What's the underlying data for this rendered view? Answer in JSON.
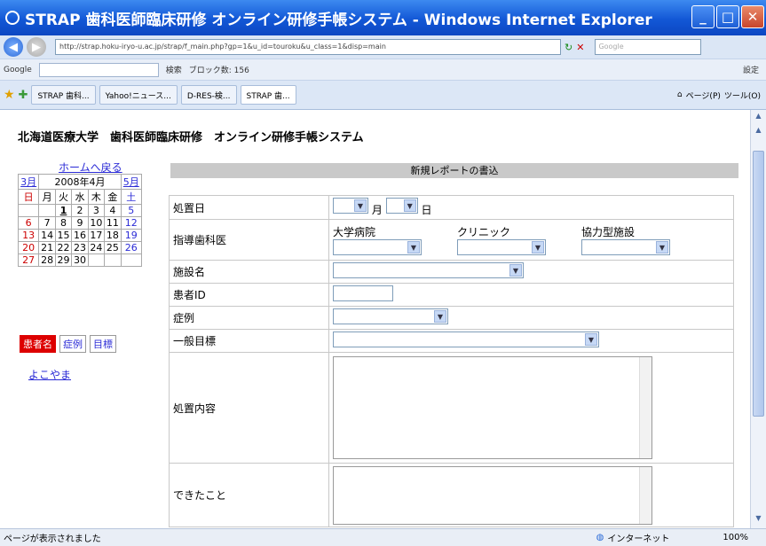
{
  "window": {
    "title": "STRAP 歯科医師臨床研修 オンライン研修手帳システム - Windows Internet Explorer",
    "url": "http://strap.hoku-iryo-u.ac.jp/strap/f_main.php?gp=1&u_id=touroku&u_class=1&disp=main",
    "search_placeholder": "Google"
  },
  "google_bar": {
    "label": "Google",
    "search_btn": "検索",
    "blocked": "ブロック数: 156",
    "settings": "設定"
  },
  "tabs": [
    {
      "label": "STRAP 歯科..."
    },
    {
      "label": "Yahoo!ニュース..."
    },
    {
      "label": "D-RES-検..."
    },
    {
      "label": "STRAP 歯..."
    }
  ],
  "toolbar": {
    "page": "ページ(P)",
    "tools": "ツール(O)"
  },
  "page": {
    "title": "北海道医療大学　歯科医師臨床研修　オンライン研修手帳システム",
    "home_link": "ホームへ戻る",
    "form_heading": "新規レポートの書込",
    "user_link": "よこやま"
  },
  "calendar": {
    "prev": "3月",
    "current": "2008年4月",
    "next": "5月",
    "weekdays": [
      "日",
      "月",
      "火",
      "水",
      "木",
      "金",
      "土"
    ],
    "weeks": [
      [
        "",
        "",
        "1",
        "2",
        "3",
        "4",
        "5"
      ],
      [
        "6",
        "7",
        "8",
        "9",
        "10",
        "11",
        "12"
      ],
      [
        "13",
        "14",
        "15",
        "16",
        "17",
        "18",
        "19"
      ],
      [
        "20",
        "21",
        "22",
        "23",
        "24",
        "25",
        "26"
      ],
      [
        "27",
        "28",
        "29",
        "30",
        "",
        "",
        ""
      ]
    ]
  },
  "side_tabs": [
    "患者名",
    "症例",
    "目標"
  ],
  "form": {
    "date_label": "処置日",
    "month_unit": "月",
    "day_unit": "日",
    "instructor_label": "指導歯科医",
    "instructor_cols": [
      "大学病院",
      "クリニック",
      "協力型施設"
    ],
    "facility_label": "施設名",
    "patient_label": "患者ID",
    "case_label": "症例",
    "goal_label": "一般目標",
    "treatment_label": "処置内容",
    "done_label": "できたこと"
  },
  "status": {
    "text": "ページが表示されました",
    "zone": "インターネット",
    "zoom": "100%"
  },
  "colors": {
    "title_bar": "#1257d6",
    "link": "#2b2bd6",
    "active_tab": "#dd0000"
  }
}
